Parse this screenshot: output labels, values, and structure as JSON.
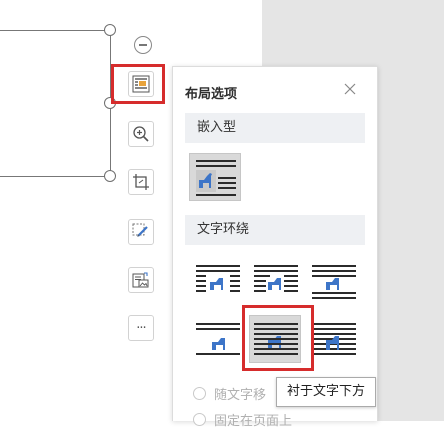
{
  "toolbar": {
    "buttons": [
      {
        "name": "layout-options-button",
        "icon": "layout-options-icon",
        "highlighted": true
      },
      {
        "name": "zoom-button",
        "icon": "zoom-in-icon"
      },
      {
        "name": "crop-button",
        "icon": "crop-icon"
      },
      {
        "name": "edit-image-button",
        "icon": "pen-icon"
      },
      {
        "name": "convert-image-button",
        "icon": "image-convert-icon"
      },
      {
        "name": "more-button",
        "icon": "more-icon",
        "label": "···"
      }
    ]
  },
  "panel": {
    "title": "布局选项",
    "close_icon": "close-icon",
    "inline_section": {
      "label": "嵌入型",
      "selected_option": "inline"
    },
    "wrap_section": {
      "label": "文字环绕",
      "options": [
        "square",
        "tight",
        "top-bottom",
        "through",
        "behind-text",
        "in-front-of-text"
      ],
      "hovered_option": "behind-text"
    },
    "radio_options": [
      {
        "label": "随文字移",
        "checked": false
      },
      {
        "label": "固定在页面上",
        "checked": false
      }
    ]
  },
  "tooltip": {
    "text": "衬于文字下方"
  },
  "colors": {
    "accent_blue": "#3d75c8",
    "highlight_red": "#d62c2c",
    "text_line": "#2b2b2b",
    "selected_bg": "#d9d9d9"
  }
}
